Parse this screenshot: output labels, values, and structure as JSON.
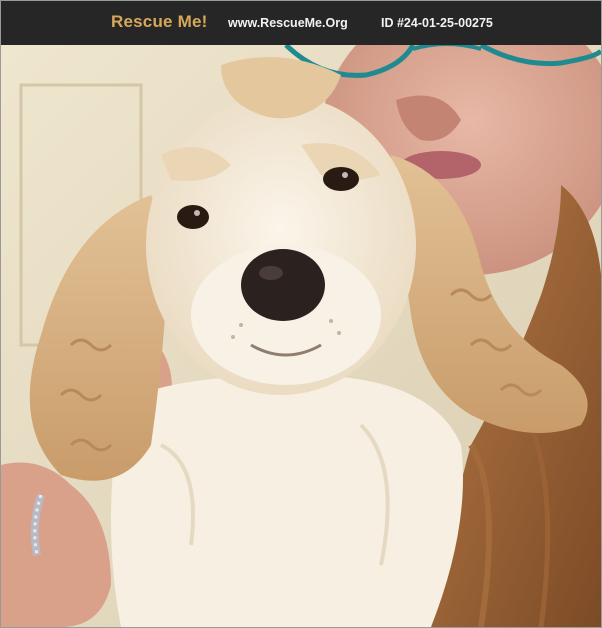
{
  "banner": {
    "brand": "Rescue Me!",
    "site": "www.RescueMe.Org",
    "pet_id": "ID #24-01-25-00275"
  },
  "colors": {
    "banner_bg": "#262626",
    "brand": "#d7a85a",
    "banner_text": "#f2f2f2"
  },
  "photo": {
    "subject": "cocker-spaniel-puppy-held-by-person"
  }
}
